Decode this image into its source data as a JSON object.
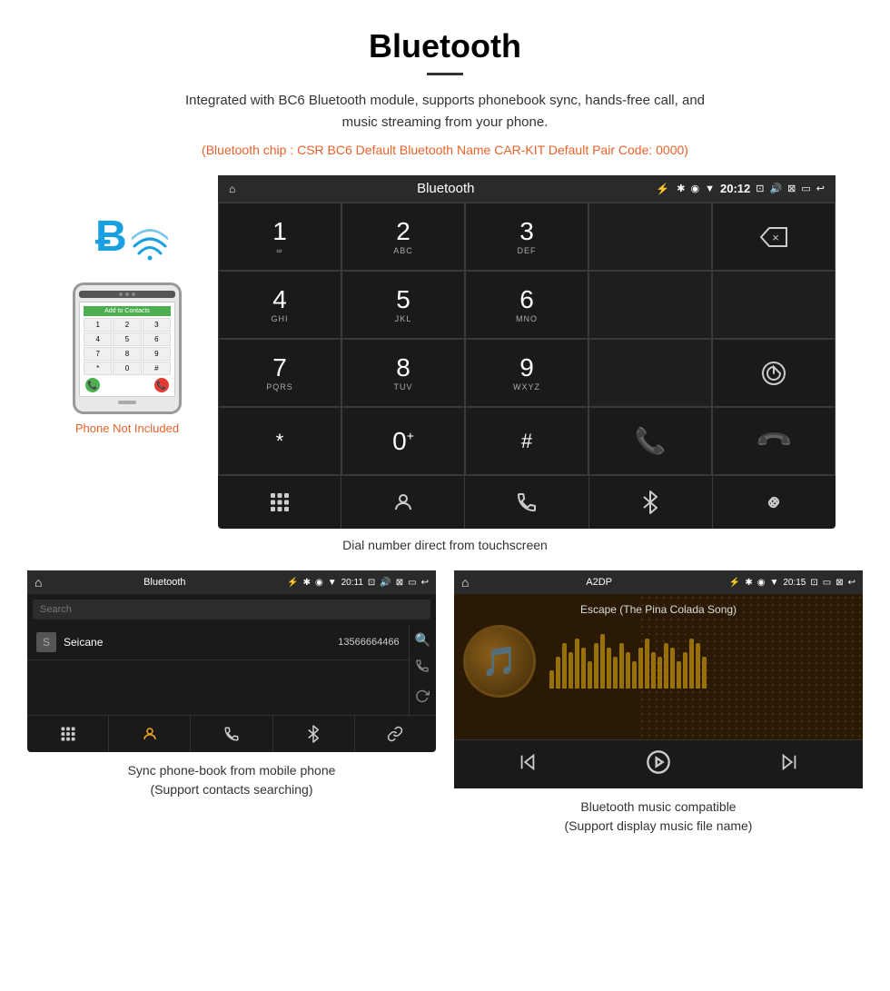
{
  "page": {
    "title": "Bluetooth",
    "subtitle": "Integrated with BC6 Bluetooth module, supports phonebook sync, hands-free call, and music streaming from your phone.",
    "specs": "(Bluetooth chip : CSR BC6    Default Bluetooth Name CAR-KIT    Default Pair Code: 0000)"
  },
  "dialpad": {
    "status_bar": {
      "home_icon": "⌂",
      "title": "Bluetooth",
      "usb_icon": "⚡",
      "bt_icon": "✱",
      "location_icon": "◎",
      "signal_icon": "▼",
      "time": "20:12",
      "camera_icon": "⊡",
      "volume_icon": "🔊",
      "mute_icon": "⊠",
      "rect_icon": "▭",
      "back_icon": "↩"
    },
    "keys": [
      {
        "num": "1",
        "sub": "∞",
        "col": 1
      },
      {
        "num": "2",
        "sub": "ABC",
        "col": 2
      },
      {
        "num": "3",
        "sub": "DEF",
        "col": 3
      },
      {
        "num": "",
        "sub": "",
        "col": 4
      },
      {
        "num": "⌫",
        "sub": "",
        "col": 5
      },
      {
        "num": "4",
        "sub": "GHI",
        "col": 1
      },
      {
        "num": "5",
        "sub": "JKL",
        "col": 2
      },
      {
        "num": "6",
        "sub": "MNO",
        "col": 3
      },
      {
        "num": "",
        "sub": "",
        "col": 4
      },
      {
        "num": "",
        "sub": "",
        "col": 5
      },
      {
        "num": "7",
        "sub": "PQRS",
        "col": 1
      },
      {
        "num": "8",
        "sub": "TUV",
        "col": 2
      },
      {
        "num": "9",
        "sub": "WXYZ",
        "col": 3
      },
      {
        "num": "",
        "sub": "",
        "col": 4
      },
      {
        "num": "↻",
        "sub": "",
        "col": 5
      },
      {
        "num": "*",
        "sub": "",
        "col": 1
      },
      {
        "num": "0⁺",
        "sub": "",
        "col": 2
      },
      {
        "num": "#",
        "sub": "",
        "col": 3
      },
      {
        "num": "📞green",
        "sub": "",
        "col": 4
      },
      {
        "num": "📞red",
        "sub": "",
        "col": 5
      }
    ],
    "bottom_icons": [
      "⊞",
      "👤",
      "☎",
      "✱",
      "🔗"
    ],
    "caption": "Dial number direct from touchscreen"
  },
  "phone_mockup": {
    "not_included_label": "Phone Not Included",
    "add_to_contacts": "Add to Contacts",
    "keys": [
      "1",
      "2",
      "3",
      "4",
      "5",
      "6",
      "7",
      "8",
      "9",
      "*",
      "0",
      "#"
    ]
  },
  "phonebook_screen": {
    "status_title": "Bluetooth",
    "time": "20:11",
    "search_placeholder": "Search",
    "contact_initial": "S",
    "contact_name": "Seicane",
    "contact_number": "13566664466",
    "caption_line1": "Sync phone-book from mobile phone",
    "caption_line2": "(Support contacts searching)"
  },
  "music_screen": {
    "status_title": "A2DP",
    "time": "20:15",
    "song_title": "Escape (The Pina Colada Song)",
    "bar_heights": [
      20,
      35,
      50,
      40,
      55,
      45,
      30,
      50,
      60,
      45,
      35,
      50,
      40,
      30,
      45,
      55,
      40,
      35,
      50,
      45,
      30,
      40,
      55,
      50,
      35
    ],
    "caption_line1": "Bluetooth music compatible",
    "caption_line2": "(Support display music file name)"
  }
}
